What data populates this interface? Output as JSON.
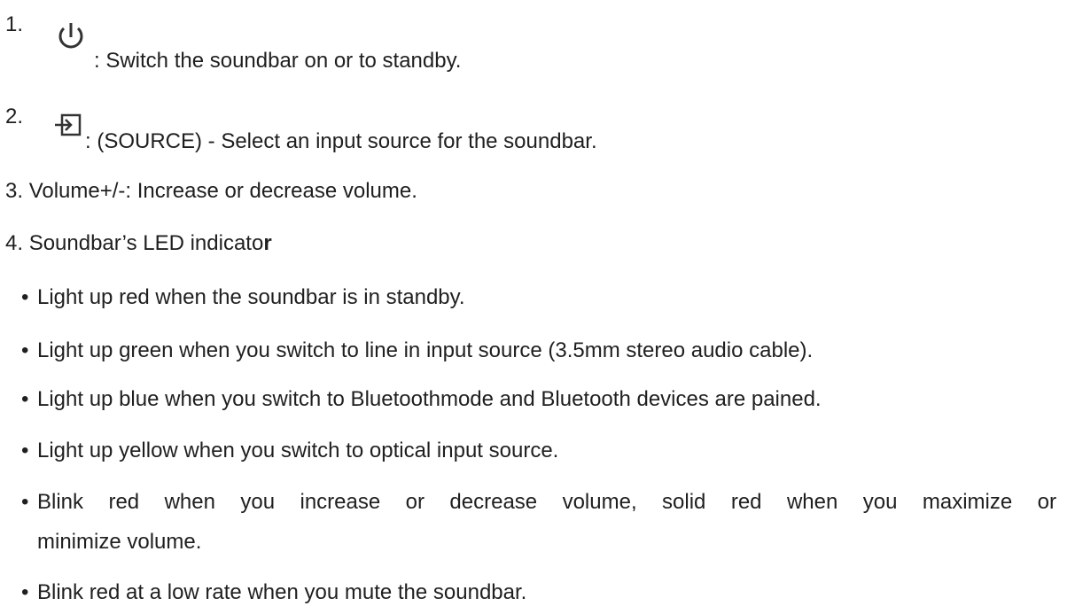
{
  "items": [
    {
      "number": "1.",
      "icon": "power-icon",
      "text": ": Switch the soundbar on or to standby."
    },
    {
      "number": "2.",
      "icon": "source-input-icon",
      "text": ": (SOURCE) - Select an input source for the soundbar."
    },
    {
      "number": "3.",
      "text": "Volume+/-: Increase or decrease volume."
    },
    {
      "number": "4.",
      "text_main": "Soundbar’s LED indicato",
      "text_bold": "r"
    }
  ],
  "bullets": [
    "Light up red when the soundbar is in standby.",
    "Light up green when you switch to line in input source (3.5mm stereo audio cable).",
    "Light up blue when you switch to Bluetoothmode and Bluetooth devices are pained.",
    "Light up yellow when you switch to optical input source.",
    "Blink red when you increase or decrease volume, solid red when you maximize or",
    "minimize volume.",
    "Blink red at a low rate when you mute the soundbar."
  ],
  "bullet_symbol": "•"
}
